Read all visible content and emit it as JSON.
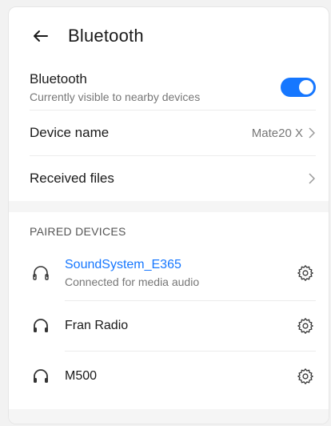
{
  "header": {
    "title": "Bluetooth"
  },
  "bluetooth": {
    "label": "Bluetooth",
    "subtitle": "Currently visible to nearby devices",
    "enabled": true,
    "accent": "#1677ff"
  },
  "device_name": {
    "label": "Device name",
    "value": "Mate20 X"
  },
  "received_files": {
    "label": "Received files"
  },
  "paired": {
    "section_title": "PAIRED DEVICES",
    "devices": [
      {
        "name": "SoundSystem_E365",
        "status": "Connected for media audio",
        "icon": "headphones-outline-icon"
      },
      {
        "name": "Fran Radio",
        "icon": "headphones-icon"
      },
      {
        "name": "M500",
        "icon": "headphones-icon"
      }
    ]
  }
}
